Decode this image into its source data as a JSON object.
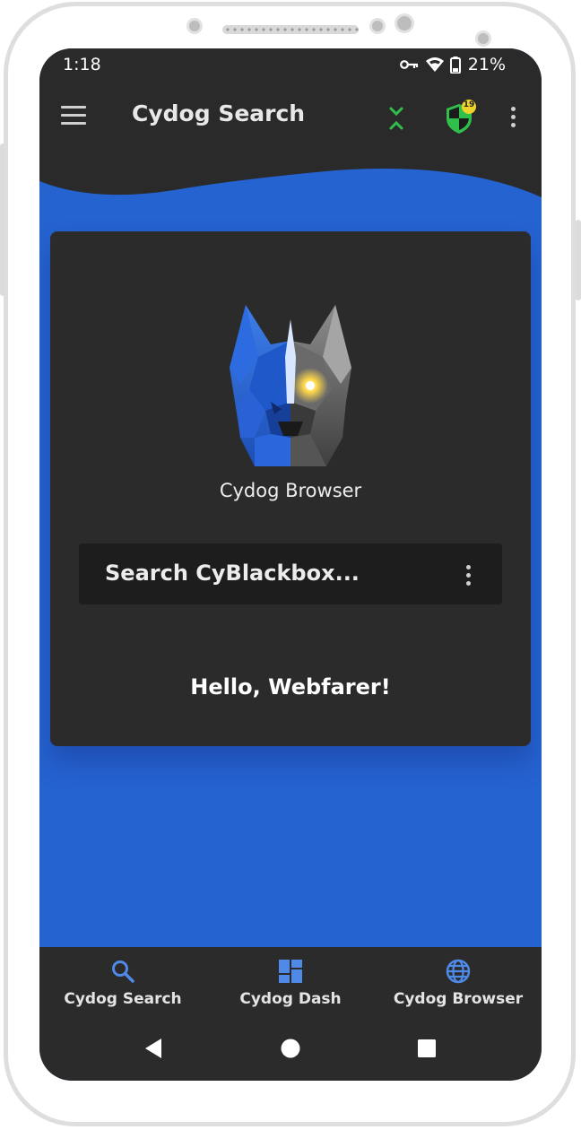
{
  "status_bar": {
    "time": "1:18",
    "battery": "21%",
    "icons": [
      "key-icon",
      "wifi-icon",
      "battery-icon"
    ]
  },
  "app_bar": {
    "title": "Cydog Search",
    "shield_badge": "19",
    "icons": [
      "menu-icon",
      "collapse-arrows-icon",
      "shield-icon",
      "more-vert-icon"
    ]
  },
  "card": {
    "logo_caption": "Cydog Browser",
    "search_placeholder": "Search CyBlackbox...",
    "greeting": "Hello, Webfarer!"
  },
  "bottom_nav": {
    "items": [
      {
        "label": "Cydog Search",
        "icon": "search-icon"
      },
      {
        "label": "Cydog Dash",
        "icon": "dashboard-icon"
      },
      {
        "label": "Cydog Browser",
        "icon": "globe-icon"
      }
    ]
  },
  "colors": {
    "background_blue": "#2563d1",
    "bar_dark": "#2a2a2a",
    "card_dark": "#2b2b2b",
    "accent_green": "#2fbf4a",
    "nav_icon_blue": "#4f8ae8",
    "badge_yellow": "#f0d32a"
  }
}
